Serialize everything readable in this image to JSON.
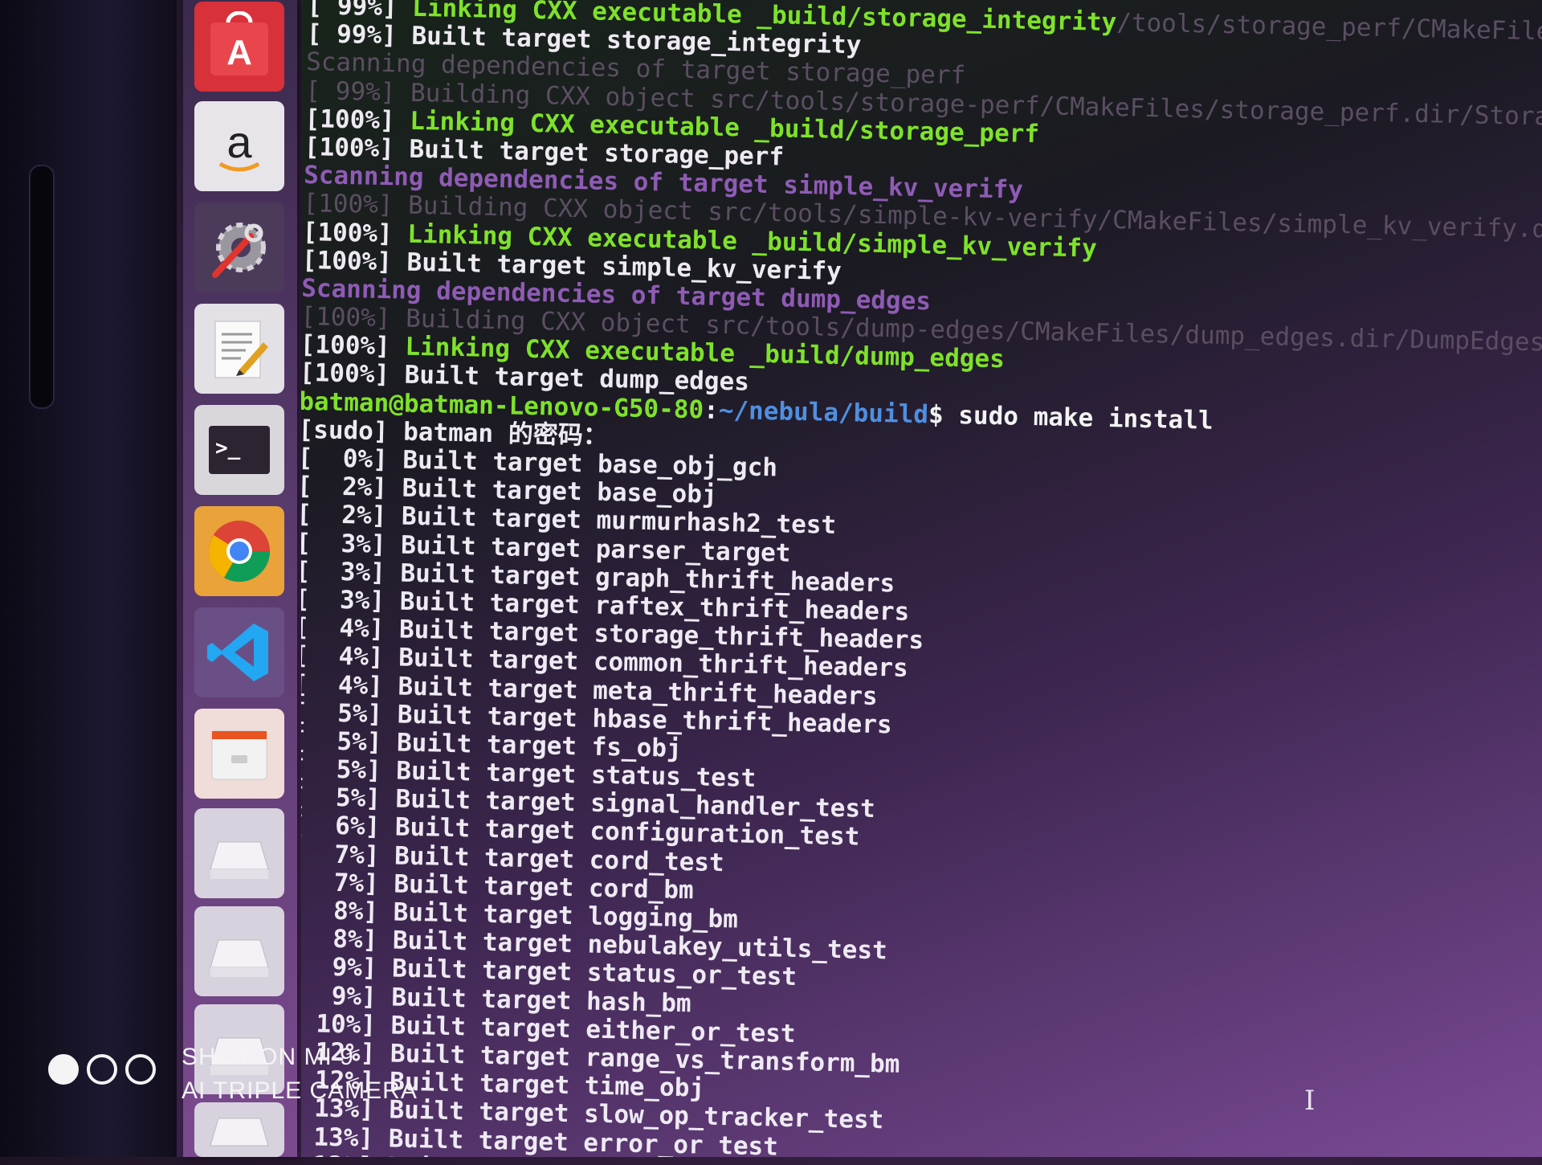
{
  "dock": {
    "items": [
      {
        "name": "software-center",
        "label": "A"
      },
      {
        "name": "amazon",
        "label": "a"
      },
      {
        "name": "system-settings",
        "label": ""
      },
      {
        "name": "text-editor",
        "label": ""
      },
      {
        "name": "terminal",
        "label": ">_"
      },
      {
        "name": "chrome",
        "label": ""
      },
      {
        "name": "vscode",
        "label": ""
      },
      {
        "name": "files",
        "label": ""
      },
      {
        "name": "drive-1",
        "label": ""
      },
      {
        "name": "drive-2",
        "label": ""
      },
      {
        "name": "drive-3",
        "label": ""
      },
      {
        "name": "drive-4",
        "label": ""
      }
    ]
  },
  "terminal": {
    "lines": [
      {
        "type": "link",
        "pct": "[ 99%]",
        "text": "Linking CXX executable _build/storage_integrity",
        "tail": "/tools/storage_perf/CMakeFiles/storage_integrity.dir/Sto"
      },
      {
        "type": "built",
        "pct": "[ 99%]",
        "text": "Built target storage_integrity",
        "tail": ""
      },
      {
        "type": "dim",
        "pct": "",
        "text": "Scanning dependencies of target storage_perf",
        "tail": ""
      },
      {
        "type": "dim",
        "pct": "[ 99%]",
        "text": "Building CXX object src/tools/storage-perf/CMakeFiles/storage_perf.dir/StorageP",
        "tail": ""
      },
      {
        "type": "link",
        "pct": "[100%]",
        "text": "Linking CXX executable _build/storage_perf",
        "tail": ""
      },
      {
        "type": "built",
        "pct": "[100%]",
        "text": "Built target storage_perf",
        "tail": ""
      },
      {
        "type": "scan",
        "pct": "",
        "text": "Scanning dependencies of target simple_kv_verify",
        "tail": ""
      },
      {
        "type": "dim",
        "pct": "[100%]",
        "text": "Building CXX object src/tools/simple-kv-verify/CMakeFiles/simple_kv_verify.dir/",
        "tail": ""
      },
      {
        "type": "link",
        "pct": "[100%]",
        "text": "Linking CXX executable _build/simple_kv_verify",
        "tail": ""
      },
      {
        "type": "built",
        "pct": "[100%]",
        "text": "Built target simple_kv_verify",
        "tail": ""
      },
      {
        "type": "scan",
        "pct": "",
        "text": "Scanning dependencies of target dump_edges",
        "tail": ""
      },
      {
        "type": "dim",
        "pct": "[100%]",
        "text": "Building CXX object src/tools/dump-edges/CMakeFiles/dump_edges.dir/DumpEdgesTool",
        "tail": ""
      },
      {
        "type": "link",
        "pct": "[100%]",
        "text": "Linking CXX executable _build/dump_edges",
        "tail": ""
      },
      {
        "type": "built",
        "pct": "[100%]",
        "text": "Built target dump_edges",
        "tail": ""
      },
      {
        "type": "prompt",
        "pct": "",
        "text": "",
        "tail": ""
      },
      {
        "type": "built",
        "pct": "[sudo]",
        "text": "batman 的密码：",
        "tail": ""
      },
      {
        "type": "built",
        "pct": "[  0%]",
        "text": "Built target base_obj_gch",
        "tail": ""
      },
      {
        "type": "built",
        "pct": "[  2%]",
        "text": "Built target base_obj",
        "tail": ""
      },
      {
        "type": "built",
        "pct": "[  2%]",
        "text": "Built target murmurhash2_test",
        "tail": ""
      },
      {
        "type": "built",
        "pct": "[  3%]",
        "text": "Built target parser_target",
        "tail": ""
      },
      {
        "type": "built",
        "pct": "[  3%]",
        "text": "Built target graph_thrift_headers",
        "tail": ""
      },
      {
        "type": "built",
        "pct": "[  3%]",
        "text": "Built target raftex_thrift_headers",
        "tail": ""
      },
      {
        "type": "built",
        "pct": "[  4%]",
        "text": "Built target storage_thrift_headers",
        "tail": ""
      },
      {
        "type": "built",
        "pct": "[  4%]",
        "text": "Built target common_thrift_headers",
        "tail": ""
      },
      {
        "type": "built",
        "pct": "[  4%]",
        "text": "Built target meta_thrift_headers",
        "tail": ""
      },
      {
        "type": "built",
        "pct": "[  5%]",
        "text": "Built target hbase_thrift_headers",
        "tail": ""
      },
      {
        "type": "built",
        "pct": "[  5%]",
        "text": "Built target fs_obj",
        "tail": ""
      },
      {
        "type": "built",
        "pct": "[  5%]",
        "text": "Built target status_test",
        "tail": ""
      },
      {
        "type": "built",
        "pct": "[  5%]",
        "text": "Built target signal_handler_test",
        "tail": ""
      },
      {
        "type": "built",
        "pct": "[  6%]",
        "text": "Built target configuration_test",
        "tail": ""
      },
      {
        "type": "built",
        "pct": "[  7%]",
        "text": "Built target cord_test",
        "tail": ""
      },
      {
        "type": "built",
        "pct": "[  7%]",
        "text": "Built target cord_bm",
        "tail": ""
      },
      {
        "type": "built",
        "pct": "[  8%]",
        "text": "Built target logging_bm",
        "tail": ""
      },
      {
        "type": "built",
        "pct": "[  8%]",
        "text": "Built target nebulakey_utils_test",
        "tail": ""
      },
      {
        "type": "built",
        "pct": "[  9%]",
        "text": "Built target status_or_test",
        "tail": ""
      },
      {
        "type": "built",
        "pct": "[  9%]",
        "text": "Built target hash_bm",
        "tail": ""
      },
      {
        "type": "built",
        "pct": "[ 10%]",
        "text": "Built target either_or_test",
        "tail": ""
      },
      {
        "type": "built",
        "pct": "[ 12%]",
        "text": "Built target range_vs_transform_bm",
        "tail": ""
      },
      {
        "type": "built",
        "pct": "[ 12%]",
        "text": "Built target time_obj",
        "tail": ""
      },
      {
        "type": "built",
        "pct": "[ 13%]",
        "text": "Built target slow_op_tracker_test",
        "tail": ""
      },
      {
        "type": "built",
        "pct": "[ 13%]",
        "text": "Built target error_or_test",
        "tail": ""
      },
      {
        "type": "built",
        "pct": "[ 13%]",
        "text": "Built target lru_test",
        "tail": ""
      }
    ],
    "prompt": {
      "user": "batman@batman-Lenovo-G50-80",
      "sep": ":",
      "path": "~/nebula/build",
      "dollar": "$ ",
      "command": "sudo make install"
    }
  },
  "watermark": {
    "line1": "SHOT ON MI 9",
    "line2": "AI TRIPLE CAMERA"
  },
  "colors": {
    "link_green": "#7ee22a",
    "scan_purple": "#8f5bb5",
    "path_blue": "#4f8fe0",
    "dock_orange": "#e95420"
  }
}
